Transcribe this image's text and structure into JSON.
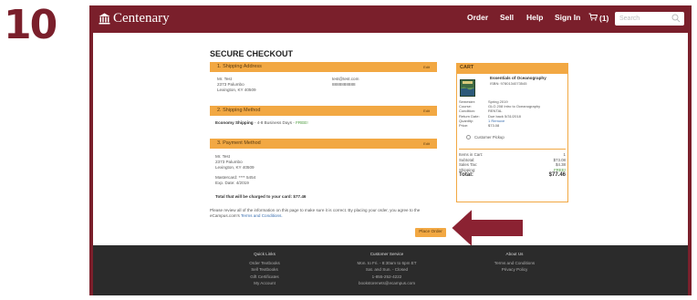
{
  "step_number": "10",
  "header": {
    "logo_text": "Centenary",
    "nav": [
      "Order",
      "Sell",
      "Help",
      "Sign In"
    ],
    "cart_label": "(1)",
    "search_placeholder": "Search"
  },
  "checkout": {
    "title": "SECURE CHECKOUT",
    "edit_label": "Edit",
    "shipping_address": {
      "heading": "1. Shipping Address",
      "name": "Mr. Test",
      "street": "2373 Palumbo",
      "city": "Lexington, KY 40509",
      "email": "test@test.com",
      "phone": "8888888888"
    },
    "shipping_method": {
      "heading": "2. Shipping Method",
      "method": "Economy Shipping",
      "detail": " - 4-8 Business Days - ",
      "price": "FREE!"
    },
    "payment_method": {
      "heading": "3. Payment Method",
      "name": "Mr. Test",
      "street": "2373 Palumbo",
      "city": "Lexington, KY 40509",
      "card": "Mastercard: **** 5454",
      "exp": "Exp. Date: 4/2019"
    },
    "total_line": "Total that will be charged to your card: $77.46",
    "review_text": "Please review all of the information on this page to make sure it is correct. By placing your order, you agree to the eCampus.com's ",
    "terms_link": "Terms and Conditions.",
    "place_order": "Place Order"
  },
  "cart": {
    "heading": "CART",
    "item": {
      "title": "Essentials of Oceanography",
      "isbn": "ISBN: 9780134073545",
      "rows": [
        {
          "label": "Semester:",
          "value": "Spring 2019"
        },
        {
          "label": "Course:",
          "value": "GLG 208 Intro to Oceanography"
        },
        {
          "label": "Condition:",
          "value": "RENTAL"
        },
        {
          "label": "Return Date:",
          "value": "Due back 5/31/2018"
        },
        {
          "label": "Quantity:",
          "value": "1 Remove"
        },
        {
          "label": "Price:",
          "value": "$73.08"
        }
      ],
      "pickup": "Customer Pickup"
    },
    "summary": [
      {
        "label": "Items in Cart:",
        "value": "1"
      },
      {
        "label": "Subtotal:",
        "value": "$73.08"
      },
      {
        "label": "Sales Tax:",
        "value": "$4.38"
      },
      {
        "label": "Shipping:",
        "value": "FREE!"
      }
    ],
    "total_label": "Total:",
    "total_value": "$77.46"
  },
  "footer": {
    "quick_links": {
      "heading": "Quick Links",
      "items": [
        "Order Textbooks",
        "Sell Textbooks",
        "Gift Certificates",
        "My Account"
      ]
    },
    "service": {
      "heading": "Customer Service",
      "items": [
        "Mon. to Fri. - 8:30am to 6pm ET",
        "Sat. and Sun. - Closed",
        "1-855-252-4222",
        "bookstorenets@ecampus.com"
      ]
    },
    "about": {
      "heading": "About Us",
      "items": [
        "Terms and Conditions",
        "Privacy Policy"
      ]
    }
  },
  "colors": {
    "brand": "#7a1f2b",
    "accent": "#f2a843",
    "footer": "#2b2b2b"
  }
}
